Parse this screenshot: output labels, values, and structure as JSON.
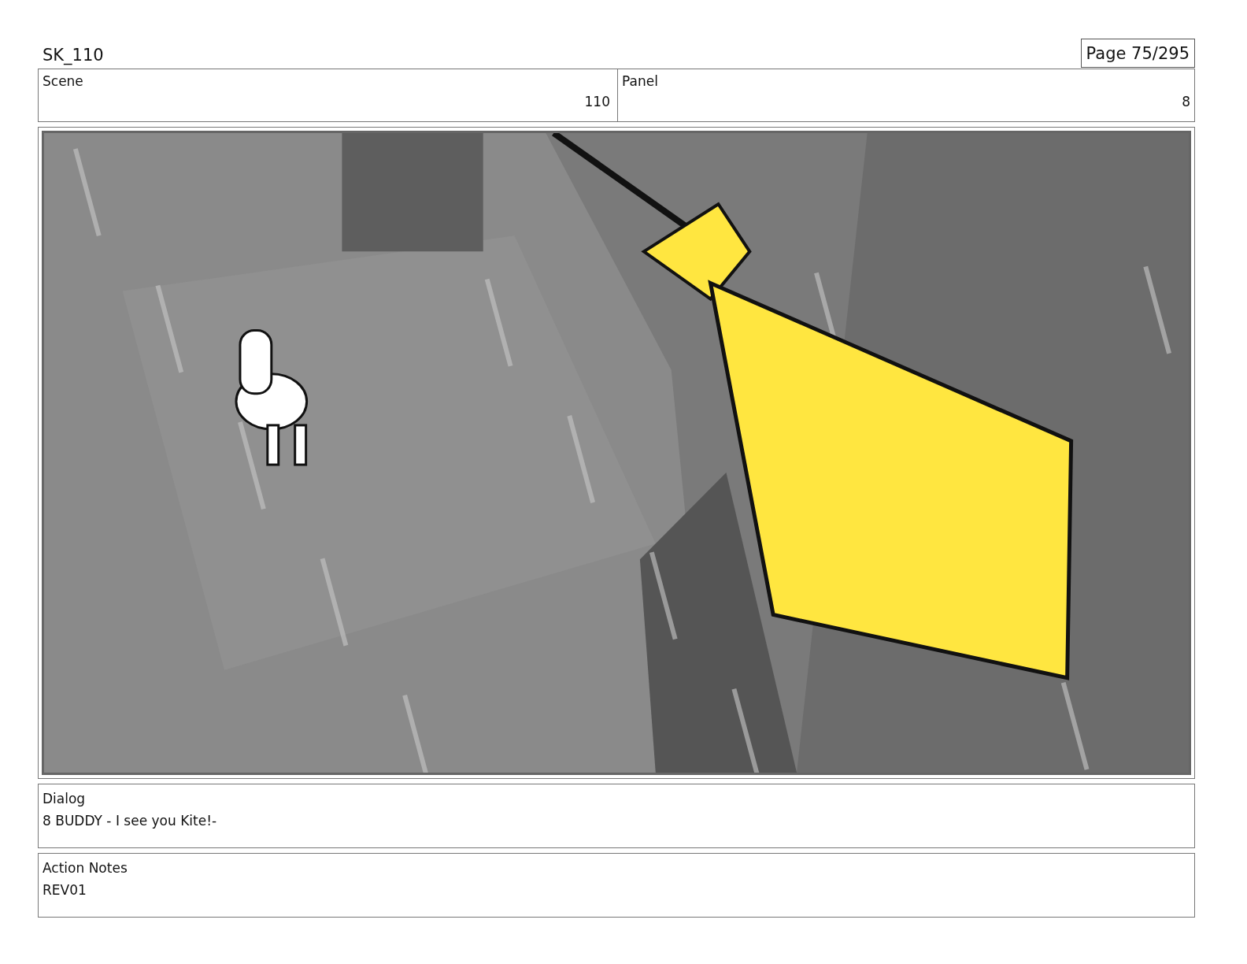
{
  "header": {
    "title": "SK_110",
    "page": "Page  75/295"
  },
  "fields": [
    {
      "label": "Scene",
      "value": "110"
    },
    {
      "label": "Panel",
      "value": "8"
    }
  ],
  "notes": [
    {
      "label": "Dialog",
      "text": "8 BUDDY - I see you Kite!-"
    },
    {
      "label": "Action Notes",
      "text": "REV01"
    }
  ]
}
